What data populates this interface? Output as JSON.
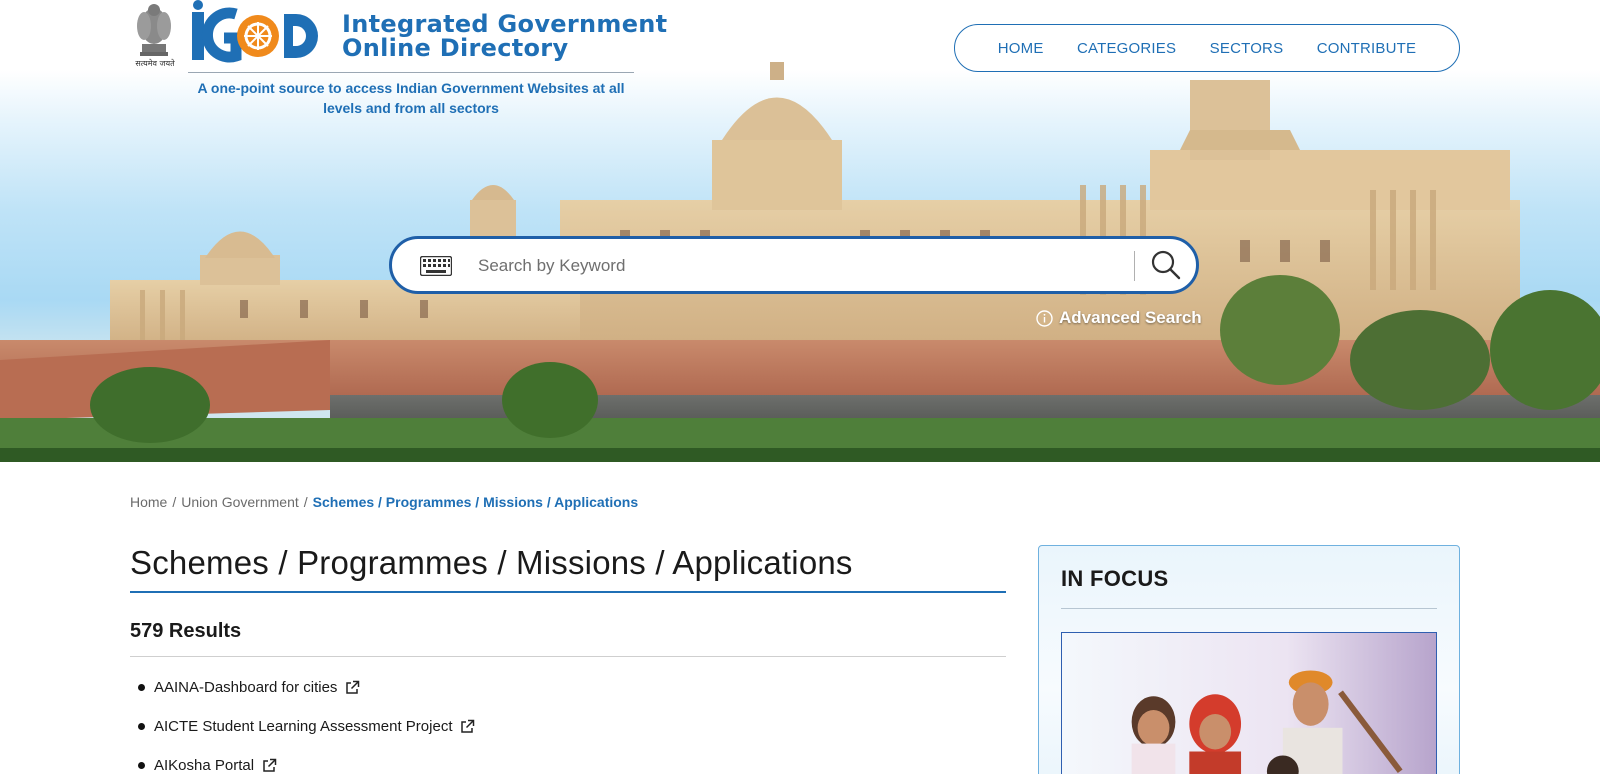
{
  "header": {
    "emblem_motto": "सत्यमेव जयते",
    "title_line1": "Integrated Government",
    "title_line2": "Online Directory",
    "tagline": "A one-point source to access Indian Government Websites at all levels and from all sectors"
  },
  "nav": {
    "items": [
      {
        "label": "HOME"
      },
      {
        "label": "CATEGORIES"
      },
      {
        "label": "SECTORS"
      },
      {
        "label": "CONTRIBUTE"
      }
    ]
  },
  "search": {
    "placeholder": "Search by Keyword",
    "advanced_label": "Advanced Search"
  },
  "breadcrumb": {
    "items": [
      "Home",
      "Union Government"
    ],
    "current": "Schemes / Programmes / Missions / Applications"
  },
  "main": {
    "title": "Schemes / Programmes / Missions / Applications",
    "results_count": "579 Results",
    "results": [
      {
        "label": "AAINA-Dashboard for cities"
      },
      {
        "label": "AICTE Student Learning Assessment Project"
      },
      {
        "label": "AIKosha Portal"
      }
    ]
  },
  "focus": {
    "title": "IN FOCUS"
  },
  "colors": {
    "brand_blue": "#1f6fb5",
    "search_border": "#1f5fa8",
    "logo_orange": "#f08a1c"
  },
  "icons": [
    "emblem-icon",
    "logo-icon",
    "keyboard-icon",
    "search-icon",
    "info-icon",
    "external-link-icon"
  ]
}
